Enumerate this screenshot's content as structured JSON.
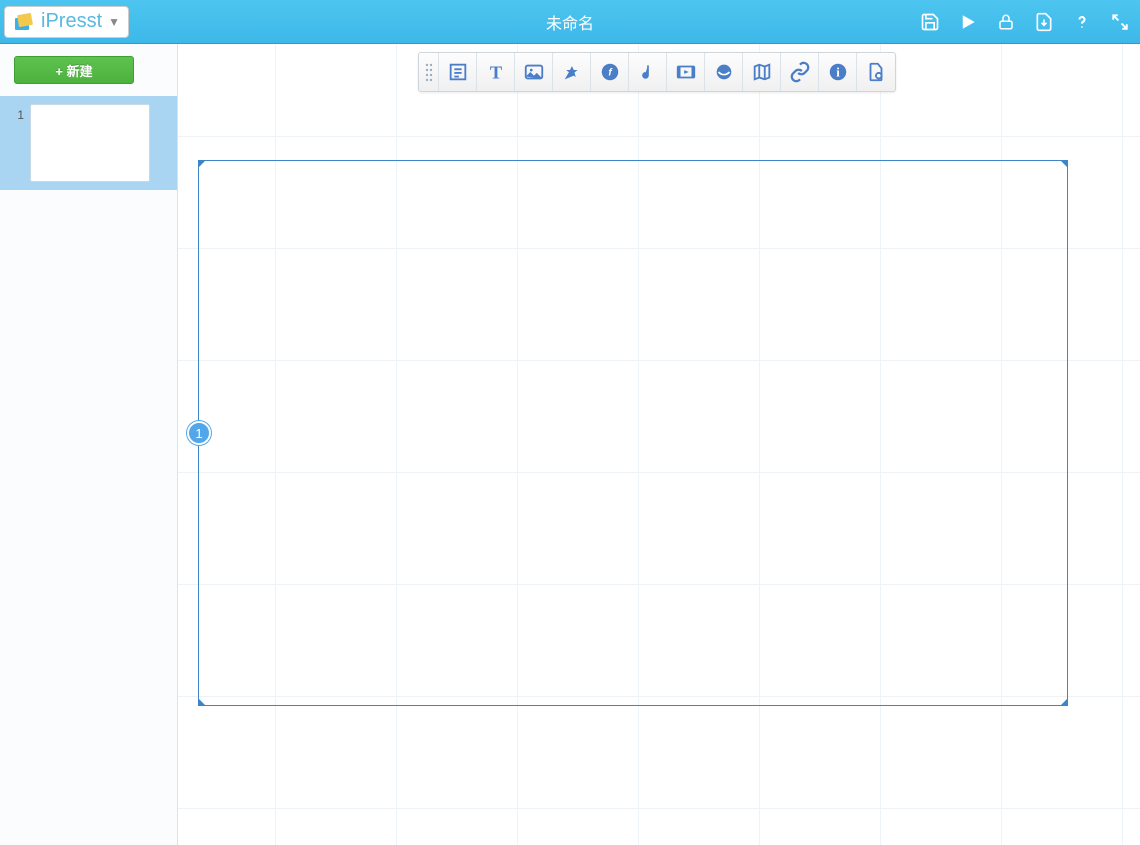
{
  "header": {
    "brand": "iPresst",
    "doc_title": "未命名",
    "actions": {
      "save": "save-icon",
      "play": "play-icon",
      "lock": "lock-icon",
      "export": "export-icon",
      "help": "help-icon",
      "fullscreen": "fullscreen-icon"
    }
  },
  "sidebar": {
    "new_label": "+ 新建",
    "slides": [
      {
        "number": "1"
      }
    ]
  },
  "toolbar": {
    "tools": [
      "handle-icon",
      "textbox-icon",
      "text-icon",
      "image-icon",
      "shape-icon",
      "flash-icon",
      "audio-icon",
      "video-icon",
      "web-icon",
      "map-icon",
      "link-icon",
      "info-icon",
      "settings-icon"
    ]
  },
  "canvas": {
    "current_slide_badge": "1"
  },
  "colors": {
    "header_bg": "#3db8e8",
    "accent_blue": "#3a86c8",
    "new_btn_green": "#4cb23e",
    "toolbar_icon": "#4a7ec8",
    "grid_line": "#eef3f7",
    "thumb_selected_bg": "#a9d4f2"
  }
}
